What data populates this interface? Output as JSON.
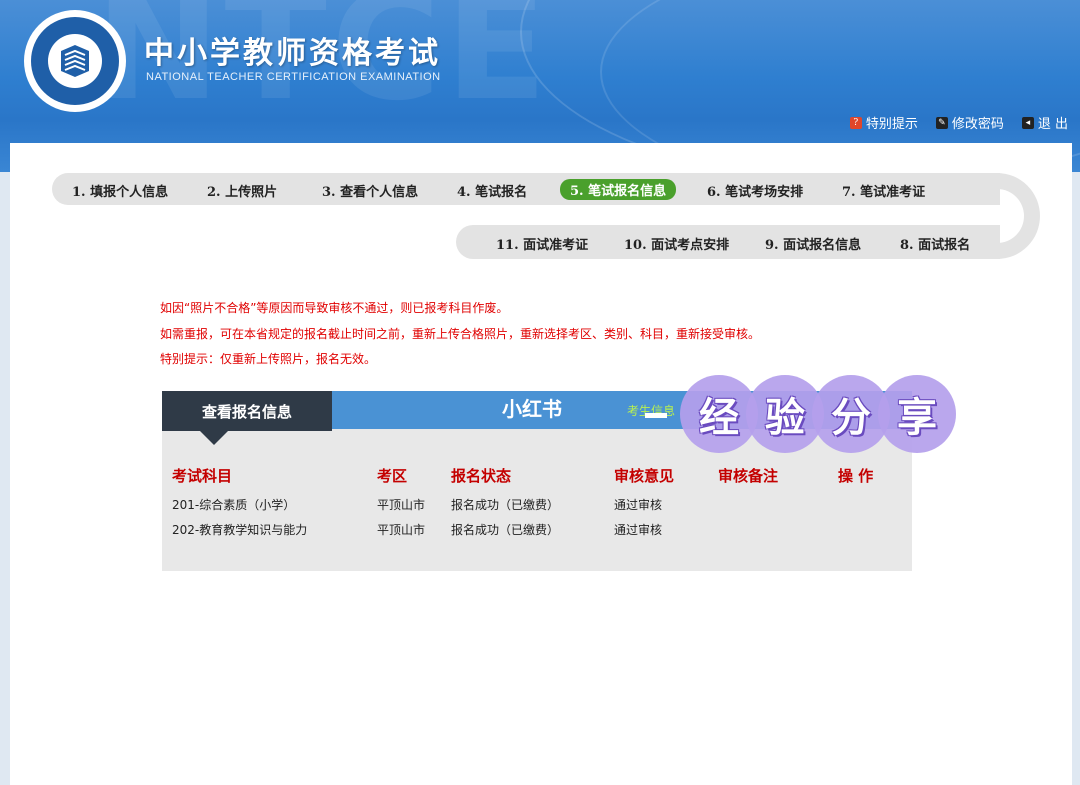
{
  "header": {
    "title": "中小学教师资格考试",
    "subtitle": "NATIONAL TEACHER CERTIFICATION EXAMINATION",
    "watermark": "NTCE",
    "links": [
      {
        "label": "特别提示",
        "icon": "alert-icon",
        "color": "#e0462a"
      },
      {
        "label": "修改密码",
        "icon": "key-icon",
        "color": "#222222"
      },
      {
        "label": "退 出",
        "icon": "logout-icon",
        "color": "#222222"
      }
    ]
  },
  "steps": {
    "s1": "1. 填报个人信息",
    "s2": "2. 上传照片",
    "s3": "3. 查看个人信息",
    "s4": "4. 笔试报名",
    "s5": "5. 笔试报名信息",
    "s6": "6. 笔试考场安排",
    "s7": "7. 笔试准考证",
    "s8": "8. 面试报名",
    "s9": "9. 面试报名信息",
    "s10": "10. 面试考点安排",
    "s11": "11. 面试准考证",
    "active": "s5",
    "active_color": "#4aa02c"
  },
  "notices": [
    "如因“照片不合格”等原因而导致审核不通过，则已报考科目作废。",
    "如需重报，可在本省规定的报名截止时间之前，重新上传合格照片，重新选择考区、类别、科目，重新接受审核。",
    "特别提示：仅重新上传照片，报名无效。"
  ],
  "info": {
    "tab_label": "查看报名信息",
    "bar_center": "小红书",
    "bar_green": "考生信息",
    "columns": [
      "考试科目",
      "考区",
      "报名状态",
      "审核意见",
      "审核备注",
      "操 作"
    ],
    "rows": [
      [
        "201-综合素质（小学）",
        "平顶山市",
        "报名成功（已缴费）",
        "通过审核",
        "",
        ""
      ],
      [
        "202-教育教学知识与能力",
        "平顶山市",
        "报名成功（已缴费）",
        "通过审核",
        "",
        ""
      ]
    ]
  },
  "overlay": {
    "chars": [
      "经",
      "验",
      "分",
      "享"
    ],
    "color": "#b4a0eb"
  }
}
